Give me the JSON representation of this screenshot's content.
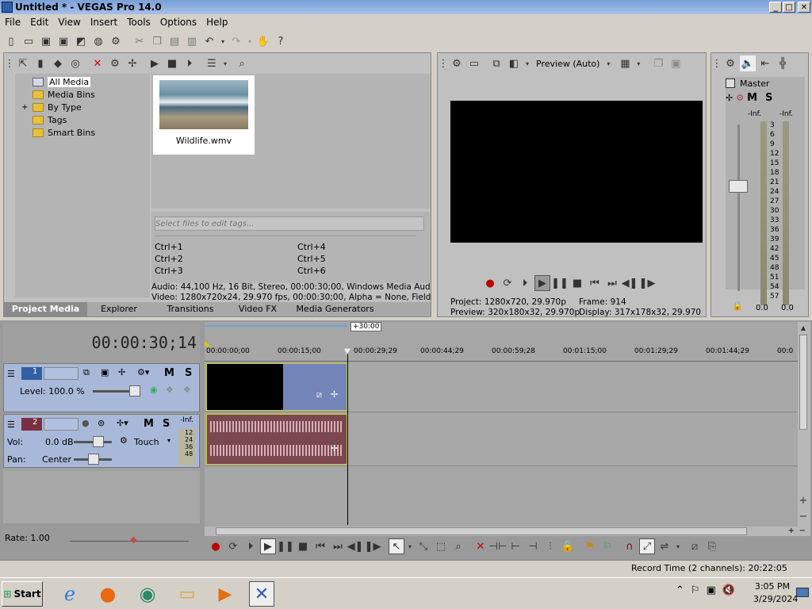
{
  "window": {
    "title": "Untitled * - VEGAS Pro 14.0"
  },
  "menu": [
    "File",
    "Edit",
    "View",
    "Insert",
    "Tools",
    "Options",
    "Help"
  ],
  "media": {
    "tree": [
      "All Media",
      "Media Bins",
      "By Type",
      "Tags",
      "Smart Bins"
    ],
    "expander": "+",
    "file_name": "Wildlife.wmv",
    "tag_placeholder": "Select files to edit tags...",
    "shortcuts": [
      "Ctrl+1",
      "Ctrl+4",
      "Ctrl+2",
      "Ctrl+5",
      "Ctrl+3",
      "Ctrl+6"
    ],
    "audio_info": "Audio: 44,100 Hz, 16 Bit, Stereo, 00:00:30;00, Windows Media Audio 9.2",
    "video_info": "Video: 1280x720x24, 29.970 fps, 00:00:30;00, Alpha = None, Field Orde"
  },
  "tabs": [
    "Project Media",
    "Explorer",
    "Transitions",
    "Video FX",
    "Media Generators"
  ],
  "preview": {
    "mode": "Preview (Auto)",
    "project_label": "Project:",
    "project_value": "1280x720, 29.970p",
    "frame_label": "Frame:",
    "frame_value": "914",
    "preview_label": "Preview:",
    "preview_value": "320x180x32, 29.970p",
    "display_label": "Display:",
    "display_value": "317x178x32, 29.970"
  },
  "master": {
    "label": "Master",
    "left": "-Inf.",
    "right": "-Inf.",
    "scale": [
      "3",
      "6",
      "9",
      "12",
      "15",
      "18",
      "21",
      "24",
      "27",
      "30",
      "33",
      "36",
      "39",
      "42",
      "45",
      "48",
      "51",
      "54",
      "57"
    ],
    "bottom_left": "0.0",
    "bottom_right": "0.0",
    "m": "M",
    "s": "S"
  },
  "timeline": {
    "time": "00:00:30;14",
    "region_label": "+30:00",
    "ruler": [
      "00:00:00;00",
      "00:00:15;00",
      "00:00:29;29",
      "00:00:44;29",
      "00:00:59;28",
      "00:01:15;00",
      "00:01:29;29",
      "00:01:44;29",
      "00:0"
    ],
    "rate": "Rate: 1.00"
  },
  "track1": {
    "num": "1",
    "level": "Level: 100.0 %",
    "m": "M",
    "s": "S"
  },
  "track2": {
    "num": "2",
    "vol_label": "Vol:",
    "vol_value": "0.0 dB",
    "pan_label": "Pan:",
    "pan_value": "Center",
    "touch": "Touch",
    "m": "M",
    "s": "S",
    "meter": [
      "-Inf.",
      "12",
      "24",
      "36",
      "48"
    ]
  },
  "status": {
    "record_time": "Record Time (2 channels): 20:22:05"
  },
  "taskbar": {
    "start": "Start",
    "time": "3:05 PM",
    "date": "3/29/2024"
  },
  "colors": {
    "accent": "#3060a0",
    "video_clip": "#7284b8",
    "audio_clip": "#7a4650",
    "track_header": "#a8b8d8"
  }
}
